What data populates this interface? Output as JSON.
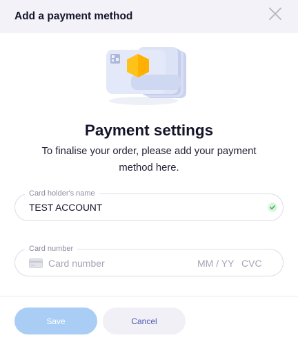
{
  "dialog": {
    "title": "Add a payment method"
  },
  "main": {
    "title": "Payment settings",
    "subtitle": "To finalise your order, please add your payment method here."
  },
  "form": {
    "holder": {
      "label": "Card holder's name",
      "value": "TEST ACCOUNT"
    },
    "card": {
      "label": "Card number",
      "number_placeholder": "Card number",
      "expiry_placeholder": "MM / YY",
      "cvc_placeholder": "CVC"
    }
  },
  "footer": {
    "save_label": "Save",
    "cancel_label": "Cancel"
  },
  "colors": {
    "header_bg": "#f2f2f8",
    "primary_disabled": "#a9cdf4",
    "secondary_bg": "#f0f0f6",
    "secondary_text": "#4a56b0",
    "success": "#2fb84f"
  },
  "icons": [
    "close-icon",
    "payment-cards-illustration",
    "check-circle-icon",
    "credit-card-icon"
  ]
}
